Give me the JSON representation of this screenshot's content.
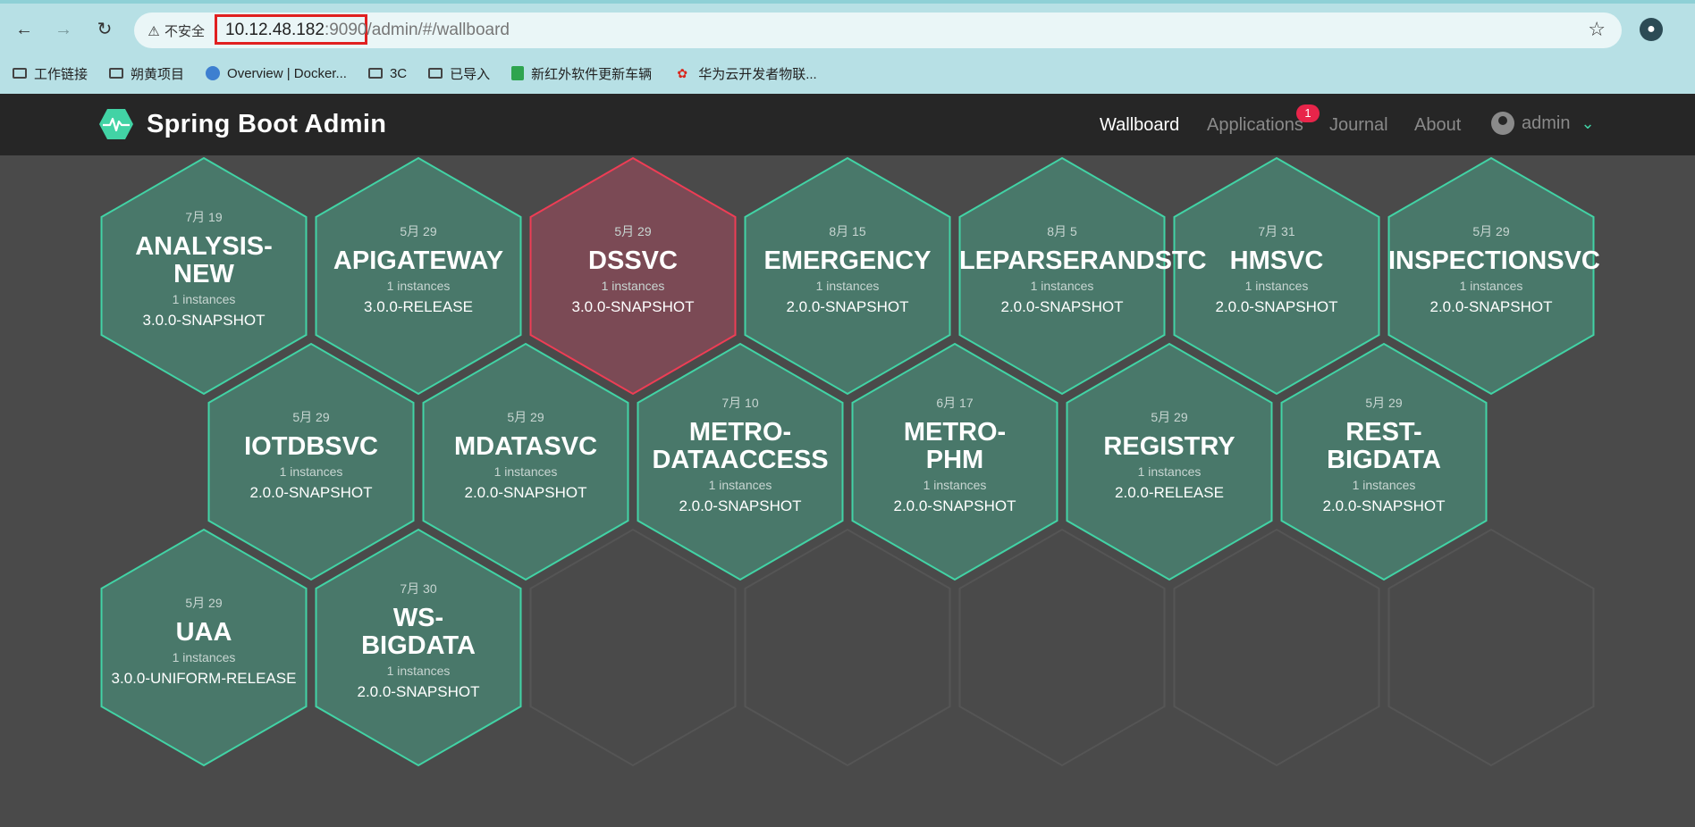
{
  "browser": {
    "security_label": "不安全",
    "url_host": "10.12.48.182",
    "url_rest": ":9090/admin/#/wallboard",
    "bookmarks": [
      {
        "label": "工作链接",
        "icon": "folder-icon"
      },
      {
        "label": "朔黄项目",
        "icon": "folder-icon"
      },
      {
        "label": "Overview | Docker...",
        "icon": "docker-icon"
      },
      {
        "label": "3C",
        "icon": "folder-icon"
      },
      {
        "label": "已导入",
        "icon": "folder-icon"
      },
      {
        "label": "新红外软件更新车辆",
        "icon": "sheet-icon"
      },
      {
        "label": "华为云开发者物联...",
        "icon": "huawei-icon"
      }
    ]
  },
  "app": {
    "title": "Spring Boot Admin",
    "nav": {
      "wallboard": "Wallboard",
      "applications": "Applications",
      "applications_badge": "1",
      "journal": "Journal",
      "about": "About",
      "user": "admin"
    },
    "colors": {
      "up_fill": "#49786a",
      "up_stroke": "#42d3a5",
      "down_fill": "#7b4a55",
      "down_stroke": "#ee3d55",
      "empty_stroke": "#555555"
    }
  },
  "applications": [
    {
      "date": "7月 19",
      "name": "ANALYSIS-\nNEW",
      "instances": "1 instances",
      "version": "3.0.0-SNAPSHOT",
      "status": "up"
    },
    {
      "date": "5月 29",
      "name": "APIGATEWAY",
      "instances": "1 instances",
      "version": "3.0.0-RELEASE",
      "status": "up"
    },
    {
      "date": "5月 29",
      "name": "DSSVC",
      "instances": "1 instances",
      "version": "3.0.0-SNAPSHOT",
      "status": "down"
    },
    {
      "date": "8月 15",
      "name": "EMERGENCY",
      "instances": "1 instances",
      "version": "2.0.0-SNAPSHOT",
      "status": "up"
    },
    {
      "date": "8月 5",
      "name": "LEPARSERANDSTC",
      "instances": "1 instances",
      "version": "2.0.0-SNAPSHOT",
      "status": "up"
    },
    {
      "date": "7月 31",
      "name": "HMSVC",
      "instances": "1 instances",
      "version": "2.0.0-SNAPSHOT",
      "status": "up"
    },
    {
      "date": "5月 29",
      "name": "INSPECTIONSVC",
      "instances": "1 instances",
      "version": "2.0.0-SNAPSHOT",
      "status": "up"
    },
    {
      "date": "5月 29",
      "name": "IOTDBSVC",
      "instances": "1 instances",
      "version": "2.0.0-SNAPSHOT",
      "status": "up"
    },
    {
      "date": "5月 29",
      "name": "MDATASVC",
      "instances": "1 instances",
      "version": "2.0.0-SNAPSHOT",
      "status": "up"
    },
    {
      "date": "7月 10",
      "name": "METRO-\nDATAACCESS",
      "instances": "1 instances",
      "version": "2.0.0-SNAPSHOT",
      "status": "up"
    },
    {
      "date": "6月 17",
      "name": "METRO-\nPHM",
      "instances": "1 instances",
      "version": "2.0.0-SNAPSHOT",
      "status": "up"
    },
    {
      "date": "5月 29",
      "name": "REGISTRY",
      "instances": "1 instances",
      "version": "2.0.0-RELEASE",
      "status": "up"
    },
    {
      "date": "5月 29",
      "name": "REST-\nBIGDATA",
      "instances": "1 instances",
      "version": "2.0.0-SNAPSHOT",
      "status": "up"
    },
    {
      "date": "5月 29",
      "name": "UAA",
      "instances": "1 instances",
      "version": "3.0.0-UNIFORM-RELEASE",
      "status": "up"
    },
    {
      "date": "7月 30",
      "name": "WS-\nBIGDATA",
      "instances": "1 instances",
      "version": "2.0.0-SNAPSHOT",
      "status": "up"
    }
  ]
}
